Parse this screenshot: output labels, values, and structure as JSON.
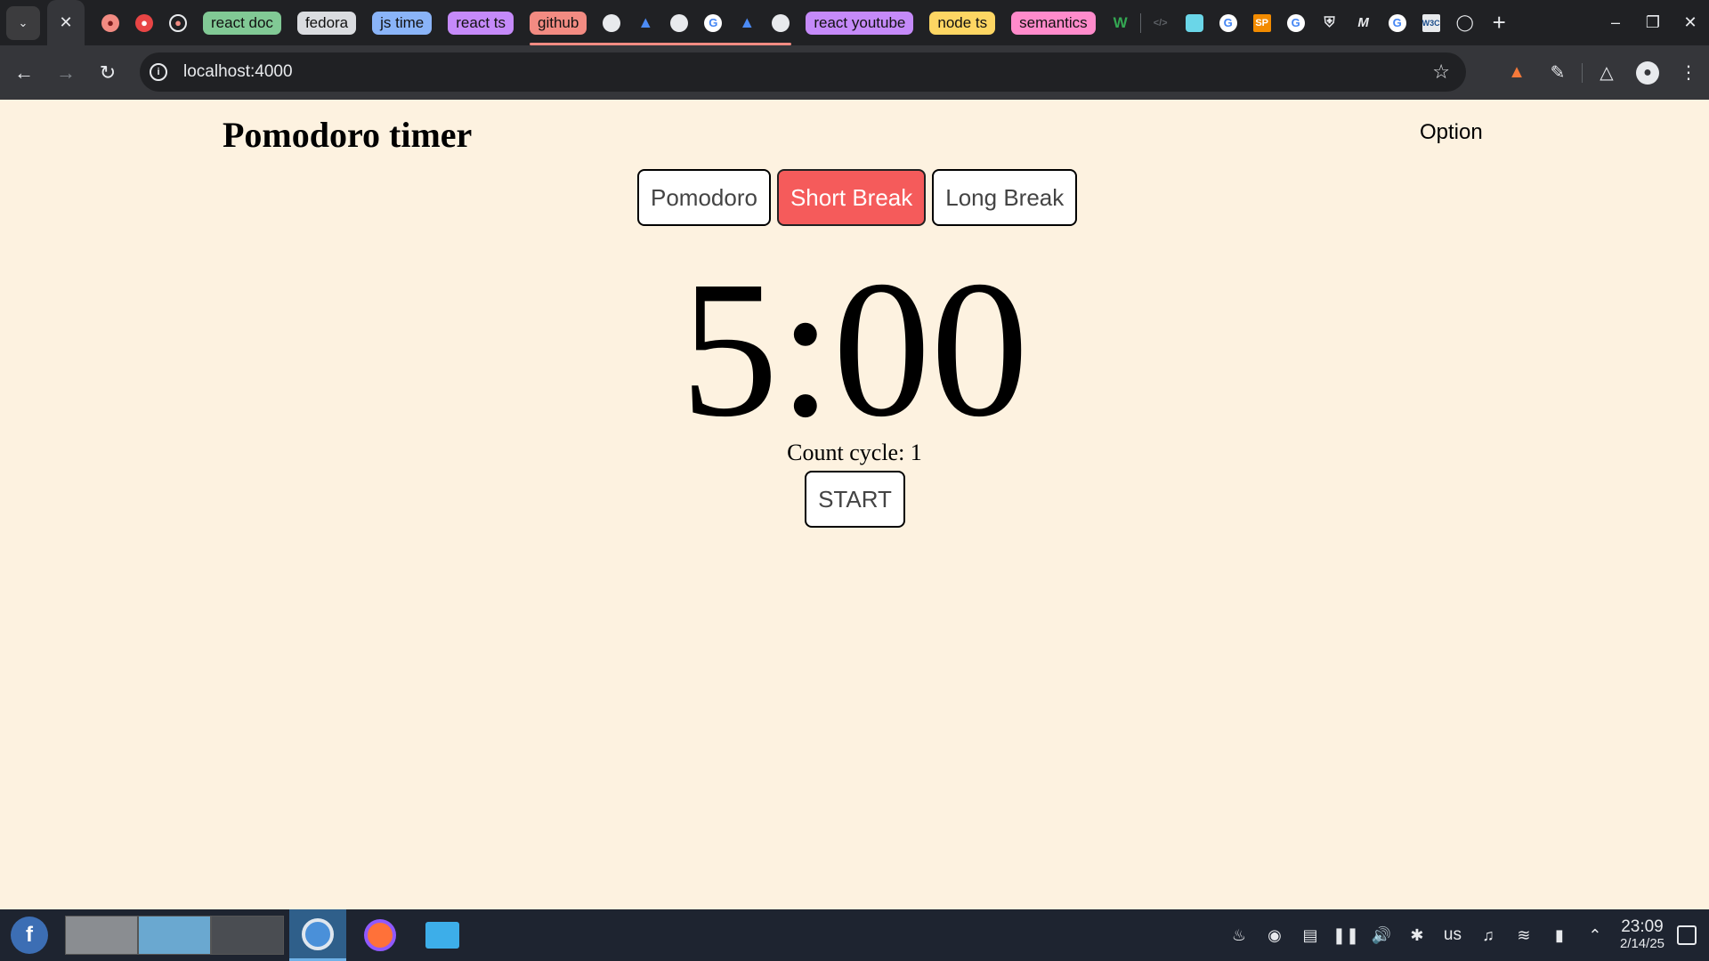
{
  "browser": {
    "tab_groups": [
      {
        "label": "react doc",
        "color": "#81c995"
      },
      {
        "label": "fedora",
        "color": "#dadce0"
      },
      {
        "label": "js time",
        "color": "#8ab4f8"
      },
      {
        "label": "react ts",
        "color": "#c58af9"
      },
      {
        "label": "github",
        "color": "#f28b82"
      },
      {
        "label": "react youtube",
        "color": "#c58af9"
      },
      {
        "label": "node ts",
        "color": "#fdd663"
      },
      {
        "label": "semantics",
        "color": "#ff8bcb"
      }
    ],
    "address": "localhost:4000",
    "accent_color": "#f28b82"
  },
  "app": {
    "title": "Pomodoro timer",
    "option_label": "Option",
    "modes": [
      {
        "label": "Pomodoro",
        "active": false
      },
      {
        "label": "Short Break",
        "active": true
      },
      {
        "label": "Long Break",
        "active": false
      }
    ],
    "timer": "5:00",
    "count_cycle": "Count cycle: 1",
    "start_label": "START",
    "active_color": "#f55b5b",
    "background_color": "#fdf2e0"
  },
  "taskbar": {
    "keyboard_layout": "us",
    "time": "23:09",
    "date": "2/14/25"
  }
}
